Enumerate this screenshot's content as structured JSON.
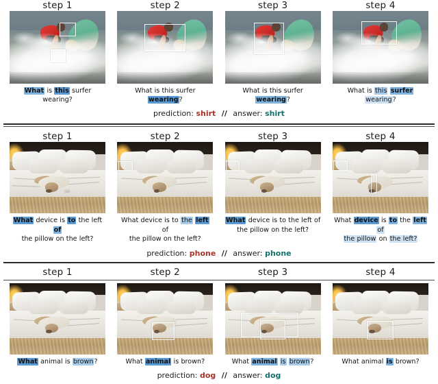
{
  "figure": {
    "step_labels": [
      "step 1",
      "step 2",
      "step 3",
      "step 4"
    ],
    "prediction_label": "prediction:",
    "answer_label": "answer:",
    "separator": "//",
    "colors": {
      "prediction": "#a6342a",
      "answer": "#14706b",
      "highlight_light": "#cfe2f3",
      "highlight_medium": "#a9ccea",
      "highlight_strong": "#7fb3e0",
      "highlight_max": "#5b9bd5",
      "rule": "#2b2b2b"
    }
  },
  "panels": [
    {
      "id": "panel-surfer",
      "scene": "surfer",
      "prediction": "shirt",
      "answer": "shirt",
      "steps": [
        {
          "label": "step 1",
          "boxes": [
            {
              "left": "52%",
              "top": "16%",
              "width": "16%",
              "height": "17%"
            },
            {
              "left": "43%",
              "top": "53%",
              "width": "14%",
              "height": "16%"
            }
          ],
          "question_tokens": [
            {
              "text": "What",
              "level": 3
            },
            {
              "text": "is",
              "level": 0
            },
            {
              "text": "this",
              "level": 4
            },
            {
              "text": "surfer",
              "level": 0
            },
            {
              "text": "wearing?",
              "level": 0
            }
          ]
        },
        {
          "label": "step 2",
          "boxes": [
            {
              "left": "28%",
              "top": "18%",
              "width": "42%",
              "height": "36%"
            }
          ],
          "question_tokens": [
            {
              "text": "What",
              "level": 0
            },
            {
              "text": "is",
              "level": 0
            },
            {
              "text": "this",
              "level": 0
            },
            {
              "text": "surfer",
              "level": 0
            },
            {
              "text": "wearing",
              "level": 4
            },
            {
              "text": "?",
              "level": 0
            }
          ]
        },
        {
          "label": "step 3",
          "boxes": [
            {
              "left": "30%",
              "top": "16%",
              "width": "30%",
              "height": "42%"
            }
          ],
          "question_tokens": [
            {
              "text": "What",
              "level": 0
            },
            {
              "text": "is",
              "level": 0
            },
            {
              "text": "this",
              "level": 0
            },
            {
              "text": "surfer",
              "level": 0
            },
            {
              "text": "wearing",
              "level": 3
            },
            {
              "text": "?",
              "level": 0
            }
          ]
        },
        {
          "label": "step 4",
          "boxes": [
            {
              "left": "30%",
              "top": "14%",
              "width": "36%",
              "height": "30%"
            }
          ],
          "question_tokens": [
            {
              "text": "What",
              "level": 0
            },
            {
              "text": "is",
              "level": 0
            },
            {
              "text": "this",
              "level": 2
            },
            {
              "text": "surfer",
              "level": 3
            },
            {
              "text": "wearing",
              "level": 1
            },
            {
              "text": "?",
              "level": 0
            }
          ]
        }
      ]
    },
    {
      "id": "panel-bed-device",
      "scene": "bedroom",
      "prediction": "phone",
      "answer": "phone",
      "steps": [
        {
          "label": "step 1",
          "boxes": [],
          "question_lines": [
            [
              {
                "text": "What",
                "level": 4
              },
              {
                "text": "device",
                "level": 0
              },
              {
                "text": "is",
                "level": 0
              },
              {
                "text": "to",
                "level": 4
              },
              {
                "text": "the",
                "level": 0
              },
              {
                "text": "left",
                "level": 0
              },
              {
                "text": "of",
                "level": 3
              }
            ],
            [
              {
                "text": "the pillow on the left?",
                "level": 0
              }
            ]
          ]
        },
        {
          "label": "step 2",
          "boxes": [
            {
              "left": "1%",
              "top": "27%",
              "width": "14%",
              "height": "12%"
            }
          ],
          "question_lines": [
            [
              {
                "text": "What",
                "level": 0
              },
              {
                "text": "device",
                "level": 0
              },
              {
                "text": "is",
                "level": 0
              },
              {
                "text": "to",
                "level": 0
              },
              {
                "text": "the",
                "level": 2
              },
              {
                "text": "left",
                "level": 4
              },
              {
                "text": "of",
                "level": 0
              }
            ],
            [
              {
                "text": "the pillow on the left?",
                "level": 0
              }
            ]
          ]
        },
        {
          "label": "step 3",
          "boxes": [
            {
              "left": "1%",
              "top": "26%",
              "width": "13%",
              "height": "13%"
            }
          ],
          "question_lines": [
            [
              {
                "text": "What",
                "level": 4
              },
              {
                "text": "device is to the left of",
                "level": 0
              }
            ],
            [
              {
                "text": "the pillow on the left?",
                "level": 0
              }
            ]
          ]
        },
        {
          "label": "step 4",
          "boxes": [
            {
              "left": "1%",
              "top": "26%",
              "width": "13%",
              "height": "13%"
            },
            {
              "left": "40%",
              "top": "44%",
              "width": "5%",
              "height": "26%"
            }
          ],
          "question_lines": [
            [
              {
                "text": "What",
                "level": 0
              },
              {
                "text": "device",
                "level": 4
              },
              {
                "text": "is",
                "level": 0
              },
              {
                "text": "to",
                "level": 3
              },
              {
                "text": "the",
                "level": 0
              },
              {
                "text": "left",
                "level": 3
              },
              {
                "text": "of",
                "level": 1
              }
            ],
            [
              {
                "text": "the pillow",
                "level": 1
              },
              {
                "text": "on",
                "level": 0
              },
              {
                "text": "the left?",
                "level": 1
              }
            ]
          ]
        }
      ]
    },
    {
      "id": "panel-bed-animal",
      "scene": "bedroom",
      "prediction": "dog",
      "answer": "dog",
      "header_rule": true,
      "steps": [
        {
          "label": "step 1",
          "boxes": [],
          "question_tokens": [
            {
              "text": "What",
              "level": 4
            },
            {
              "text": "animal",
              "level": 0
            },
            {
              "text": "is",
              "level": 0
            },
            {
              "text": "brown",
              "level": 2
            },
            {
              "text": "?",
              "level": 0
            }
          ]
        },
        {
          "label": "step 2",
          "boxes": [
            {
              "left": "36%",
              "top": "55%",
              "width": "22%",
              "height": "23%"
            }
          ],
          "question_tokens": [
            {
              "text": "What",
              "level": 0
            },
            {
              "text": "animal",
              "level": 4
            },
            {
              "text": "is",
              "level": 0
            },
            {
              "text": "brown?",
              "level": 0
            }
          ]
        },
        {
          "label": "step 3",
          "boxes": [
            {
              "left": "17%",
              "top": "42%",
              "width": "58%",
              "height": "33%"
            },
            {
              "left": "37%",
              "top": "52%",
              "width": "25%",
              "height": "25%"
            }
          ],
          "question_tokens": [
            {
              "text": "What",
              "level": 0
            },
            {
              "text": "animal",
              "level": 3
            },
            {
              "text": "is",
              "level": 2
            },
            {
              "text": "brown",
              "level": 2
            },
            {
              "text": "?",
              "level": 0
            }
          ]
        },
        {
          "label": "step 4",
          "boxes": [
            {
              "left": "36%",
              "top": "53%",
              "width": "26%",
              "height": "24%"
            }
          ],
          "question_tokens": [
            {
              "text": "What",
              "level": 0
            },
            {
              "text": "animal",
              "level": 0
            },
            {
              "text": "is",
              "level": 3
            },
            {
              "text": "brown?",
              "level": 0
            }
          ]
        }
      ]
    }
  ]
}
